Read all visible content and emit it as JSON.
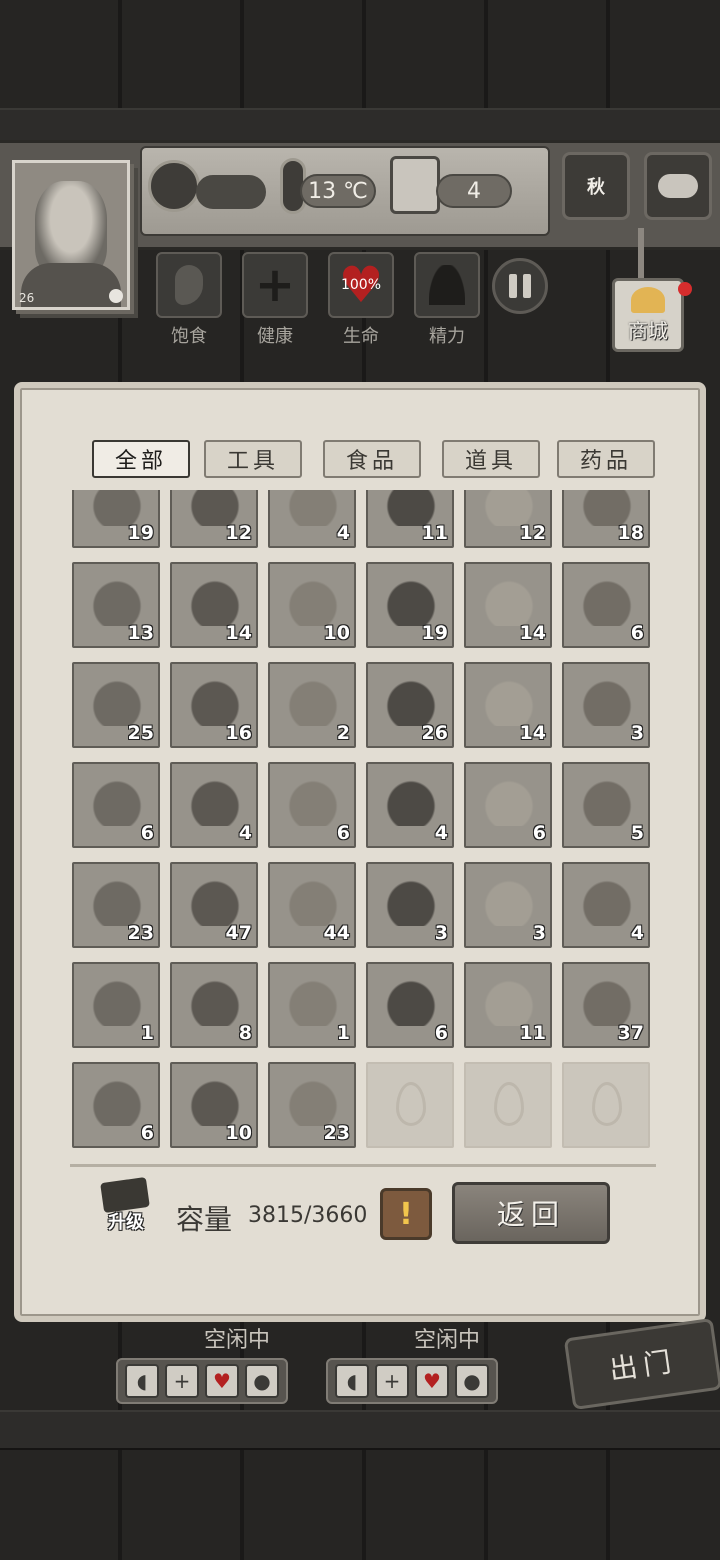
{
  "hud": {
    "level": "26",
    "time_value": "",
    "temperature": "13 ℃",
    "day": "4",
    "season": "秋",
    "shop_label": "商城"
  },
  "stats": [
    {
      "label": "饱食",
      "icon": "stomach-icon"
    },
    {
      "label": "健康",
      "icon": "cross-icon"
    },
    {
      "label": "生命",
      "icon": "heart-icon",
      "value": "100%"
    },
    {
      "label": "精力",
      "icon": "person-icon"
    }
  ],
  "tabs": [
    {
      "label": "全部",
      "active": true
    },
    {
      "label": "工具",
      "active": false
    },
    {
      "label": "食品",
      "active": false
    },
    {
      "label": "道具",
      "active": false
    },
    {
      "label": "药品",
      "active": false
    }
  ],
  "items": [
    {
      "name": "mud",
      "qty": "19"
    },
    {
      "name": "wheat",
      "qty": "12"
    },
    {
      "name": "planks",
      "qty": "4"
    },
    {
      "name": "wood-log",
      "qty": "11"
    },
    {
      "name": "stick",
      "qty": "12"
    },
    {
      "name": "dirt",
      "qty": "18"
    },
    {
      "name": "scrap-metal",
      "qty": "13"
    },
    {
      "name": "iron-parts",
      "qty": "14"
    },
    {
      "name": "salt",
      "qty": "10"
    },
    {
      "name": "stone",
      "qty": "19"
    },
    {
      "name": "worm",
      "qty": "14"
    },
    {
      "name": "animal-hide",
      "qty": "6"
    },
    {
      "name": "clay",
      "qty": "25"
    },
    {
      "name": "rocks",
      "qty": "16"
    },
    {
      "name": "cotton",
      "qty": "2"
    },
    {
      "name": "bread",
      "qty": "26"
    },
    {
      "name": "thorns",
      "qty": "14"
    },
    {
      "name": "curved-horn",
      "qty": "3"
    },
    {
      "name": "tusks",
      "qty": "6"
    },
    {
      "name": "pearl-shell",
      "qty": "4"
    },
    {
      "name": "feather",
      "qty": "6"
    },
    {
      "name": "dried-meat",
      "qty": "4"
    },
    {
      "name": "horn",
      "qty": "6"
    },
    {
      "name": "fish-oil",
      "qty": "5"
    },
    {
      "name": "shrimp",
      "qty": "23"
    },
    {
      "name": "flour",
      "qty": "47"
    },
    {
      "name": "mushrooms",
      "qty": "44"
    },
    {
      "name": "seed",
      "qty": "3"
    },
    {
      "name": "coal-pieces",
      "qty": "3"
    },
    {
      "name": "insect",
      "qty": "4"
    },
    {
      "name": "toolbox",
      "qty": "1"
    },
    {
      "name": "bottle",
      "qty": "8"
    },
    {
      "name": "amulet",
      "qty": "1"
    },
    {
      "name": "wood-board",
      "qty": "6"
    },
    {
      "name": "ore",
      "qty": "11"
    },
    {
      "name": "medkit-gift",
      "qty": "37"
    },
    {
      "name": "medkit-gift",
      "qty": "6"
    },
    {
      "name": "medkit-gift",
      "qty": "10"
    },
    {
      "name": "medkit-gift",
      "qty": "23"
    },
    {
      "name": "empty",
      "qty": ""
    },
    {
      "name": "empty",
      "qty": ""
    },
    {
      "name": "empty",
      "qty": ""
    }
  ],
  "footer": {
    "upgrade_label": "升级",
    "capacity_label": "容量",
    "capacity_value": "3815/3660",
    "warn_symbol": "!",
    "back_label": "返回"
  },
  "bottom": {
    "idle_1": "空闲中",
    "idle_2": "空闲中",
    "go_out": "出门"
  },
  "colors": {
    "panel": "#e2ddd3",
    "slot": "#97938b",
    "warning": "#f1c54d",
    "heart": "#b32020"
  }
}
